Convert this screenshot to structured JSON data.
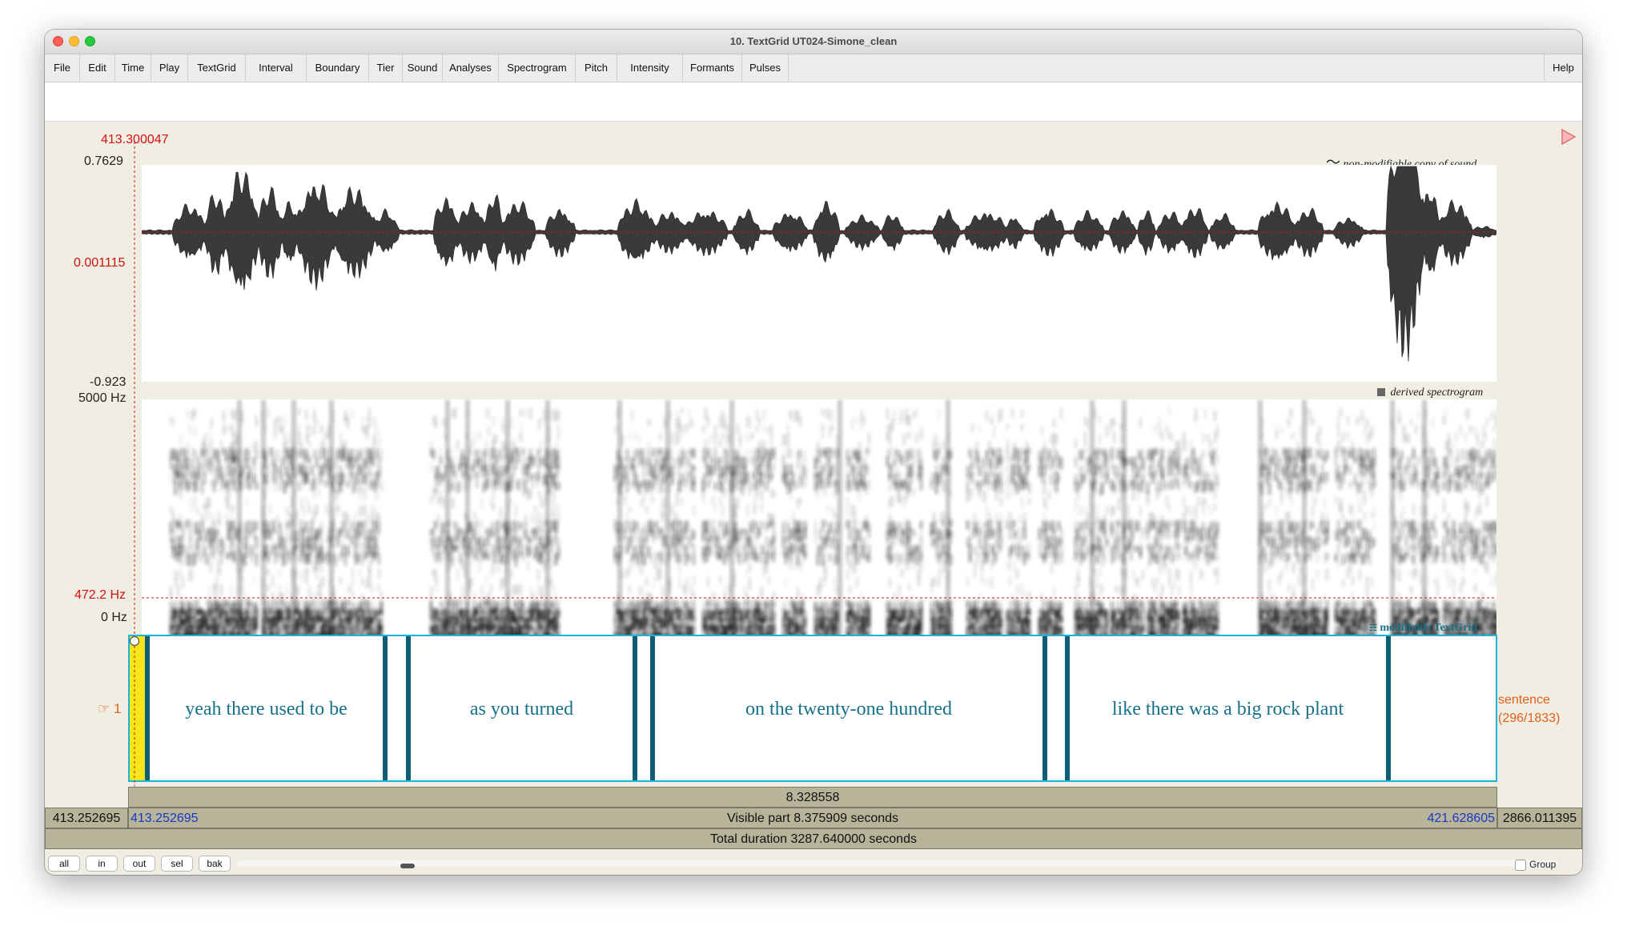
{
  "window": {
    "title": "10. TextGrid UT024-Simone_clean"
  },
  "menu": [
    "File",
    "Edit",
    "Time",
    "Play",
    "TextGrid",
    "Interval",
    "Boundary",
    "Tier",
    "Sound",
    "Analyses",
    "Spectrogram",
    "Pitch",
    "Intensity",
    "Formants",
    "Pulses"
  ],
  "help_label": "Help",
  "cursor_time": "413.300047",
  "waveform": {
    "max": "0.7629",
    "cursor_value": "0.001115",
    "min": "-0.923",
    "label": "non-modifiable copy of sound",
    "label_icon": "tilde-icon"
  },
  "spectrogram": {
    "max": "5000 Hz",
    "cursor_value": "472.2 Hz",
    "min": "0 Hz",
    "label": "derived spectrogram",
    "label_icon": "square-icon"
  },
  "textgrid": {
    "label": "modifiable TextGrid",
    "label_icon": "grid-icon",
    "tier_number": "1",
    "tier_icon": "pointing-hand-icon",
    "tier_name": "sentence",
    "tier_count": "(296/1833)",
    "intervals": [
      "yeah there used to be",
      "as you turned",
      "on the twenty-one hundred",
      "like there was a big rock plant"
    ]
  },
  "durations": {
    "selection": "8.328558",
    "left_total": "413.252695",
    "visible_start": "413.252695",
    "visible_part": "Visible part 8.375909 seconds",
    "visible_end": "421.628605",
    "right_total": "2866.011395",
    "total": "Total duration 3287.640000 seconds"
  },
  "buttons": {
    "all": "all",
    "in": "in",
    "out": "out",
    "sel": "sel",
    "bak": "bak",
    "group": "Group"
  },
  "colors": {
    "cursor_red": "#d31010",
    "textgrid_blue": "#17708a",
    "boundary_teal": "#0e5f75",
    "selection_yellow": "#f5e61c",
    "tier_orange": "#e0601a",
    "bar_khaki": "#b8b49a"
  }
}
